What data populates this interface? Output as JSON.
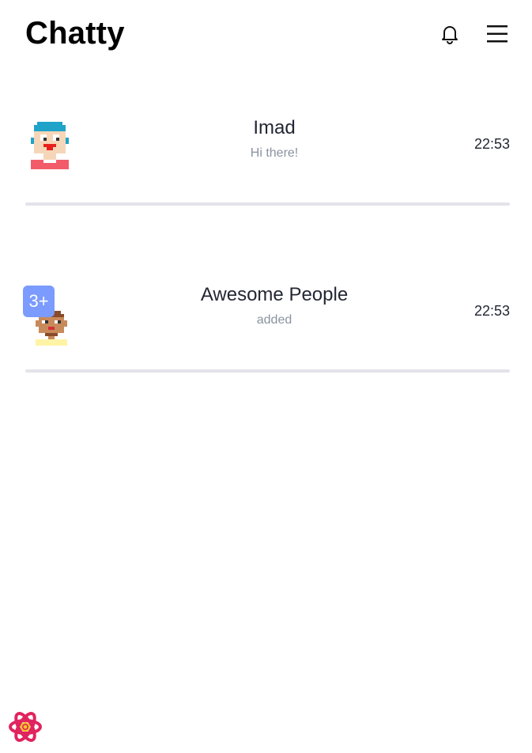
{
  "app": {
    "title": "Chatty"
  },
  "header": {
    "icons": [
      "bell-icon",
      "hamburger-menu-icon"
    ]
  },
  "chats": [
    {
      "name": "Imad",
      "preview": "Hi there!",
      "time": "22:53",
      "avatar": "pixel-avatar-blue-hair"
    },
    {
      "name": "Awesome People",
      "preview": "added",
      "time": "22:53",
      "badge": "3+",
      "avatar": "pixel-avatar-brown-hair"
    }
  ],
  "footer": {
    "logo": "react-logo-icon"
  },
  "colors": {
    "badge": "#7b9bff",
    "divider": "#e3e3ea",
    "preview_text": "#8a93a0",
    "logo": "#e0245e"
  }
}
